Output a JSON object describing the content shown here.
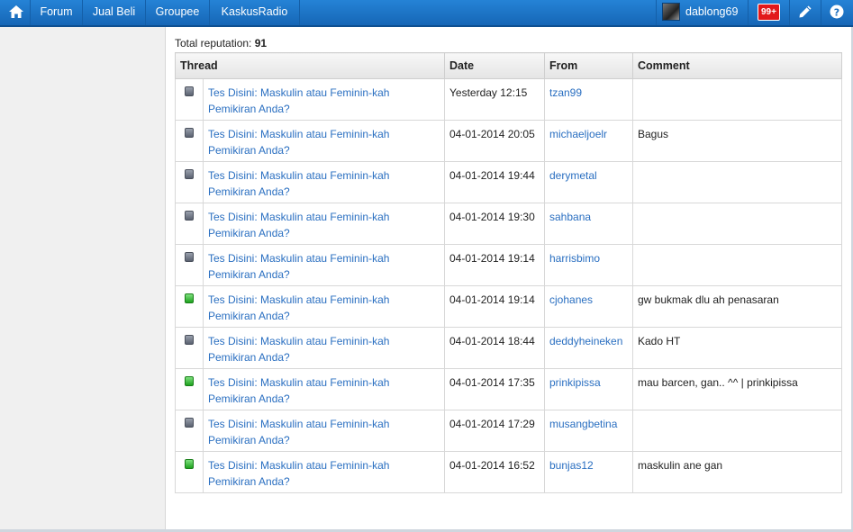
{
  "nav": {
    "items": [
      "Forum",
      "Jual Beli",
      "Groupee",
      "KaskusRadio"
    ],
    "username": "dablong69",
    "notification_badge": "99+",
    "accent_color": "#1d6fbf"
  },
  "icons": {
    "home": "home-icon",
    "edit": "pencil-icon",
    "help": "question-icon",
    "reputation_neutral": "gray-square",
    "reputation_positive": "green-square"
  },
  "reputation": {
    "label": "Total reputation:",
    "value": "91"
  },
  "table": {
    "headers": [
      "Thread",
      "Date",
      "From",
      "Comment"
    ],
    "rows": [
      {
        "type": "gray",
        "thread": "Tes Disini: Maskulin atau Feminin-kah Pemikiran Anda?",
        "date": "Yesterday 12:15",
        "from": "tzan99",
        "comment": ""
      },
      {
        "type": "gray",
        "thread": "Tes Disini: Maskulin atau Feminin-kah Pemikiran Anda?",
        "date": "04-01-2014 20:05",
        "from": "michaeljoelr",
        "comment": "Bagus"
      },
      {
        "type": "gray",
        "thread": "Tes Disini: Maskulin atau Feminin-kah Pemikiran Anda?",
        "date": "04-01-2014 19:44",
        "from": "derymetal",
        "comment": ""
      },
      {
        "type": "gray",
        "thread": "Tes Disini: Maskulin atau Feminin-kah Pemikiran Anda?",
        "date": "04-01-2014 19:30",
        "from": "sahbana",
        "comment": ""
      },
      {
        "type": "gray",
        "thread": "Tes Disini: Maskulin atau Feminin-kah Pemikiran Anda?",
        "date": "04-01-2014 19:14",
        "from": "harrisbimo",
        "comment": ""
      },
      {
        "type": "green",
        "thread": "Tes Disini: Maskulin atau Feminin-kah Pemikiran Anda?",
        "date": "04-01-2014 19:14",
        "from": "cjohanes",
        "comment": "gw bukmak dlu ah penasaran"
      },
      {
        "type": "gray",
        "thread": "Tes Disini: Maskulin atau Feminin-kah Pemikiran Anda?",
        "date": "04-01-2014 18:44",
        "from": "deddyheineken",
        "comment": "Kado HT"
      },
      {
        "type": "green",
        "thread": "Tes Disini: Maskulin atau Feminin-kah Pemikiran Anda?",
        "date": "04-01-2014 17:35",
        "from": "prinkipissa",
        "comment": "mau barcen, gan.. ^^ | prinkipissa"
      },
      {
        "type": "gray",
        "thread": "Tes Disini: Maskulin atau Feminin-kah Pemikiran Anda?",
        "date": "04-01-2014 17:29",
        "from": "musangbetina",
        "comment": ""
      },
      {
        "type": "green",
        "thread": "Tes Disini: Maskulin atau Feminin-kah Pemikiran Anda?",
        "date": "04-01-2014 16:52",
        "from": "bunjas12",
        "comment": "maskulin ane gan"
      }
    ]
  }
}
